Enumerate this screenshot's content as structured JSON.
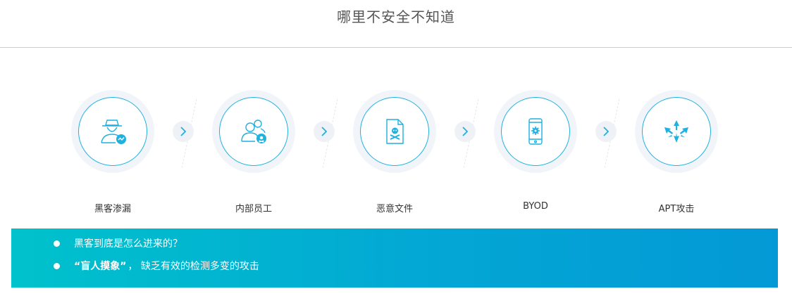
{
  "header": {
    "title": "哪里不安全不知道"
  },
  "steps": [
    {
      "label": "黑客渗漏",
      "icon": "hacker-icon"
    },
    {
      "label": "内部员工",
      "icon": "insider-user-icon"
    },
    {
      "label": "恶意文件",
      "icon": "malicious-file-icon"
    },
    {
      "label": "BYOD",
      "icon": "mobile-device-icon"
    },
    {
      "label": "APT攻击",
      "icon": "apt-attack-icon"
    }
  ],
  "arrow_icon": "chevron-right-icon",
  "colors": {
    "accent": "#1fb1e0",
    "banner_start": "#00c2cc",
    "banner_end": "#0399d6"
  },
  "banner": {
    "bullets": [
      {
        "text": "黑客到底是怎么进来的？"
      },
      {
        "strong": "“盲人摸象”",
        "text": "， 缺乏有效的检测多变的攻击"
      }
    ]
  }
}
